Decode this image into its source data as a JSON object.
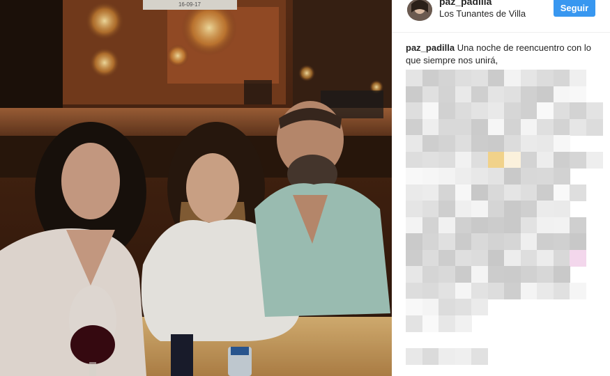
{
  "post": {
    "username": "paz_padilla",
    "location": "Los Tunantes de Villa",
    "follow_label": "Seguir",
    "caption_user": "paz_padilla",
    "caption_text": " Una noche de reencuentro con lo que siempre nos unirá,",
    "sign_text": "16-09-17"
  },
  "colors": {
    "follow_button": "#3897f0",
    "text": "#262626"
  },
  "icons": {
    "avatar": "profile-photo"
  }
}
